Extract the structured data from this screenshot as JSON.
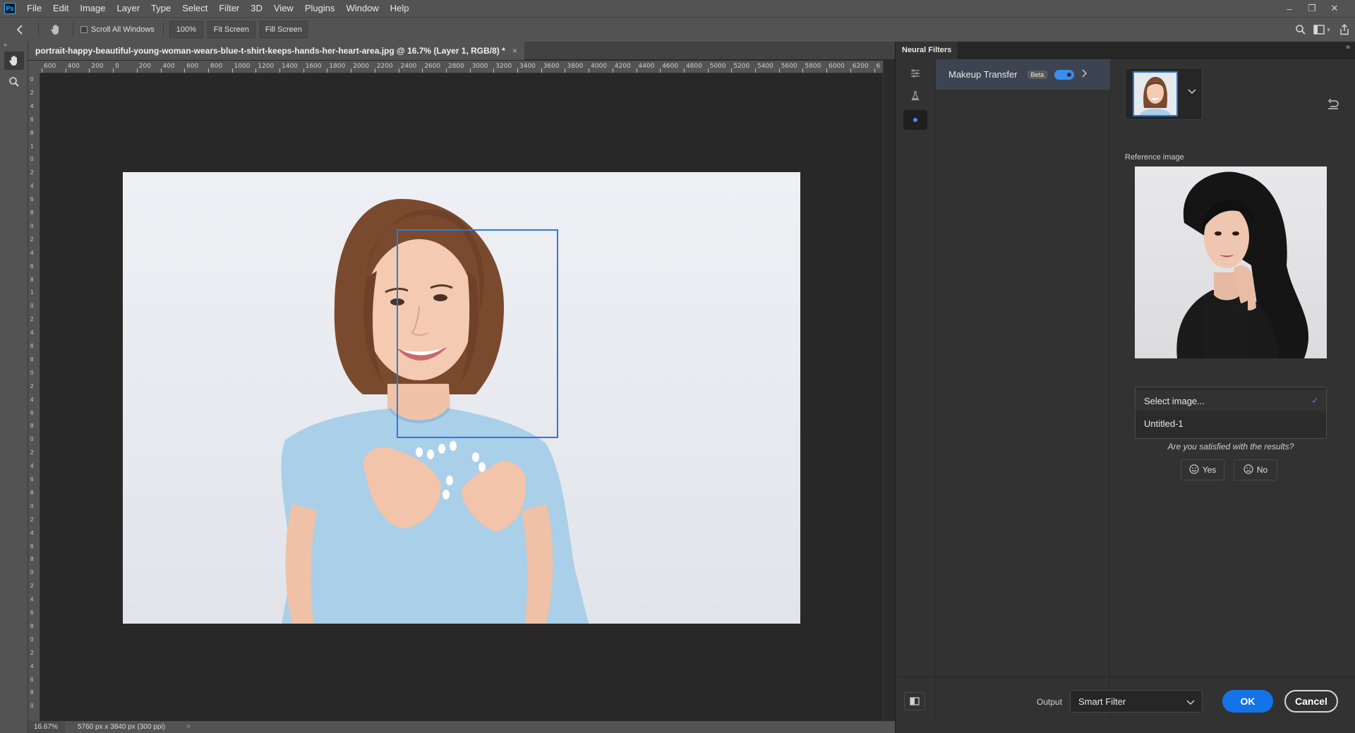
{
  "app": {
    "logo": "Ps"
  },
  "menu": [
    "File",
    "Edit",
    "Image",
    "Layer",
    "Type",
    "Select",
    "Filter",
    "3D",
    "View",
    "Plugins",
    "Window",
    "Help"
  ],
  "options_bar": {
    "scroll_all_label": "Scroll All Windows",
    "zoom_label": "100%",
    "fit_screen_label": "Fit Screen",
    "fill_screen_label": "Fill Screen"
  },
  "document": {
    "tab_title": "portrait-happy-beautiful-young-woman-wears-blue-t-shirt-keeps-hands-her-heart-area.jpg @ 16.7% (Layer 1, RGB/8) *",
    "close_glyph": "×",
    "ruler_h_labels": [
      "600",
      "400",
      "200",
      "0",
      "200",
      "400",
      "600",
      "800",
      "1000",
      "1200",
      "1400",
      "1600",
      "1800",
      "2000",
      "2200",
      "2400",
      "2600",
      "2800",
      "3000",
      "3200",
      "3400",
      "3600",
      "3800",
      "4000",
      "4200",
      "4400",
      "4600",
      "4800",
      "5000",
      "5200",
      "5400",
      "5600",
      "5800",
      "6000",
      "6200",
      "6"
    ],
    "ruler_v_labels": [
      "0",
      "2",
      "4",
      "6",
      "8",
      "1",
      "0",
      "2",
      "4",
      "6",
      "8",
      "0",
      "2",
      "4",
      "6",
      "8",
      "1",
      "0",
      "2",
      "4",
      "6",
      "8",
      "0",
      "2",
      "4",
      "6",
      "8",
      "0",
      "2",
      "4",
      "6",
      "8",
      "0",
      "2",
      "4",
      "6",
      "8",
      "0",
      "2",
      "4",
      "6",
      "8",
      "0",
      "2",
      "4",
      "6",
      "8",
      "0"
    ],
    "status_zoom": "16.67%",
    "status_info": "5760 px x 3840 px (300 ppi)",
    "status_arrow": ">"
  },
  "neural_filters": {
    "panel_title": "Neural Filters",
    "filter_name": "Makeup Transfer",
    "beta_label": "Beta",
    "filter_enabled": true,
    "reference_label": "Reference image",
    "dropdown_options": [
      {
        "label": "Select image...",
        "selected": true
      },
      {
        "label": "Untitled-1",
        "selected": false
      }
    ],
    "check_glyph": "✓",
    "feedback_question": "Are you satisfied with the results?",
    "yes_label": "Yes",
    "no_label": "No",
    "output_label": "Output",
    "output_value": "Smart Filter",
    "ok_label": "OK",
    "cancel_label": "Cancel"
  },
  "colors": {
    "accent": "#1473e6",
    "toggle_blue": "#378ef0",
    "face_box": "#2d7ad6",
    "shirt": "#a9cfe9"
  }
}
